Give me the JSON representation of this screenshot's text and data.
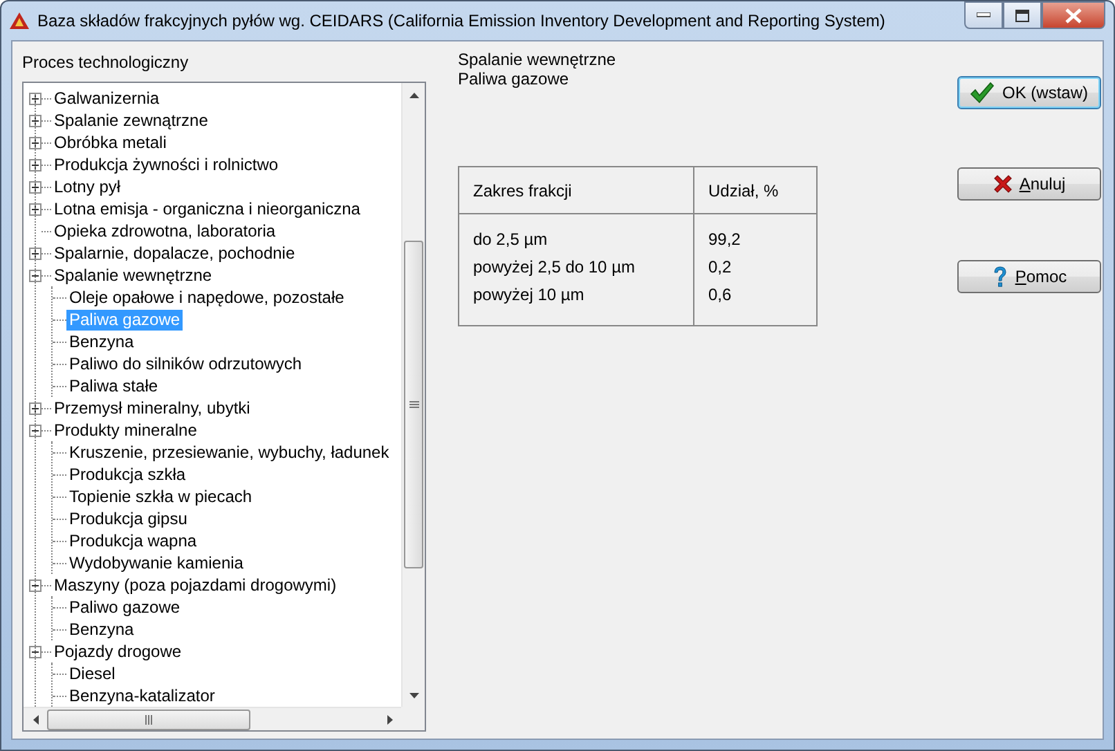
{
  "window": {
    "title": "Baza składów frakcyjnych pyłów wg. CEIDARS (California Emission Inventory Development and Reporting System)"
  },
  "tree_label": "Proces technologiczny",
  "tree": [
    {
      "label": "Galwanizernia",
      "kind": "group",
      "expanded": false,
      "selected": false
    },
    {
      "label": "Spalanie zewnątrzne",
      "kind": "group",
      "expanded": false,
      "selected": false
    },
    {
      "label": "Obróbka metali",
      "kind": "group",
      "expanded": false,
      "selected": false
    },
    {
      "label": "Produkcja żywności i rolnictwo",
      "kind": "group",
      "expanded": false,
      "selected": false
    },
    {
      "label": "Lotny pył",
      "kind": "group",
      "expanded": false,
      "selected": false
    },
    {
      "label": "Lotna emisja - organiczna i nieorganiczna",
      "kind": "group",
      "expanded": false,
      "selected": false
    },
    {
      "label": "Opieka zdrowotna, laboratoria",
      "kind": "leaf",
      "selected": false
    },
    {
      "label": "Spalarnie, dopalacze, pochodnie",
      "kind": "group",
      "expanded": false,
      "selected": false
    },
    {
      "label": "Spalanie wewnętrzne",
      "kind": "group",
      "expanded": true,
      "selected": false,
      "children": [
        {
          "label": "Oleje opałowe i napędowe, pozostałe",
          "kind": "leaf",
          "selected": false
        },
        {
          "label": "Paliwa gazowe",
          "kind": "leaf",
          "selected": true
        },
        {
          "label": "Benzyna",
          "kind": "leaf",
          "selected": false
        },
        {
          "label": "Paliwo do silników odrzutowych",
          "kind": "leaf",
          "selected": false
        },
        {
          "label": "Paliwa stałe",
          "kind": "leaf",
          "selected": false
        }
      ]
    },
    {
      "label": "Przemysł mineralny, ubytki",
      "kind": "group",
      "expanded": false,
      "selected": false
    },
    {
      "label": "Produkty mineralne",
      "kind": "group",
      "expanded": true,
      "selected": false,
      "children": [
        {
          "label": "Kruszenie, przesiewanie, wybuchy, ładunek",
          "kind": "leaf",
          "selected": false
        },
        {
          "label": "Produkcja szkła",
          "kind": "leaf",
          "selected": false
        },
        {
          "label": "Topienie szkła w piecach",
          "kind": "leaf",
          "selected": false
        },
        {
          "label": "Produkcja gipsu",
          "kind": "leaf",
          "selected": false
        },
        {
          "label": "Produkcja wapna",
          "kind": "leaf",
          "selected": false
        },
        {
          "label": "Wydobywanie kamienia",
          "kind": "leaf",
          "selected": false
        }
      ]
    },
    {
      "label": "Maszyny (poza pojazdami drogowymi)",
      "kind": "group",
      "expanded": true,
      "selected": false,
      "children": [
        {
          "label": "Paliwo gazowe",
          "kind": "leaf",
          "selected": false
        },
        {
          "label": "Benzyna",
          "kind": "leaf",
          "selected": false
        }
      ]
    },
    {
      "label": "Pojazdy drogowe",
      "kind": "group",
      "expanded": true,
      "selected": false,
      "children": [
        {
          "label": "Diesel",
          "kind": "leaf",
          "selected": false
        },
        {
          "label": "Benzyna-katalizator",
          "kind": "leaf",
          "selected": false
        }
      ]
    }
  ],
  "selection": [
    "Spalanie wewnętrzne",
    "Paliwa gazowe"
  ],
  "table": {
    "columns": [
      "Zakres frakcji",
      "Udział, %"
    ],
    "rows": [
      [
        "do 2,5 µm",
        "99,2"
      ],
      [
        "powyżej 2,5 do 10 µm",
        "0,2"
      ],
      [
        "powyżej 10 µm",
        "0,6"
      ]
    ]
  },
  "buttons": [
    {
      "label": "OK (wstaw)",
      "kind": "ok",
      "default": true,
      "mnemonic": false
    },
    {
      "label": "Anuluj",
      "kind": "cancel",
      "default": false,
      "mnemonic": true
    },
    {
      "label": "Pomoc",
      "kind": "help",
      "default": false,
      "mnemonic": true
    }
  ]
}
